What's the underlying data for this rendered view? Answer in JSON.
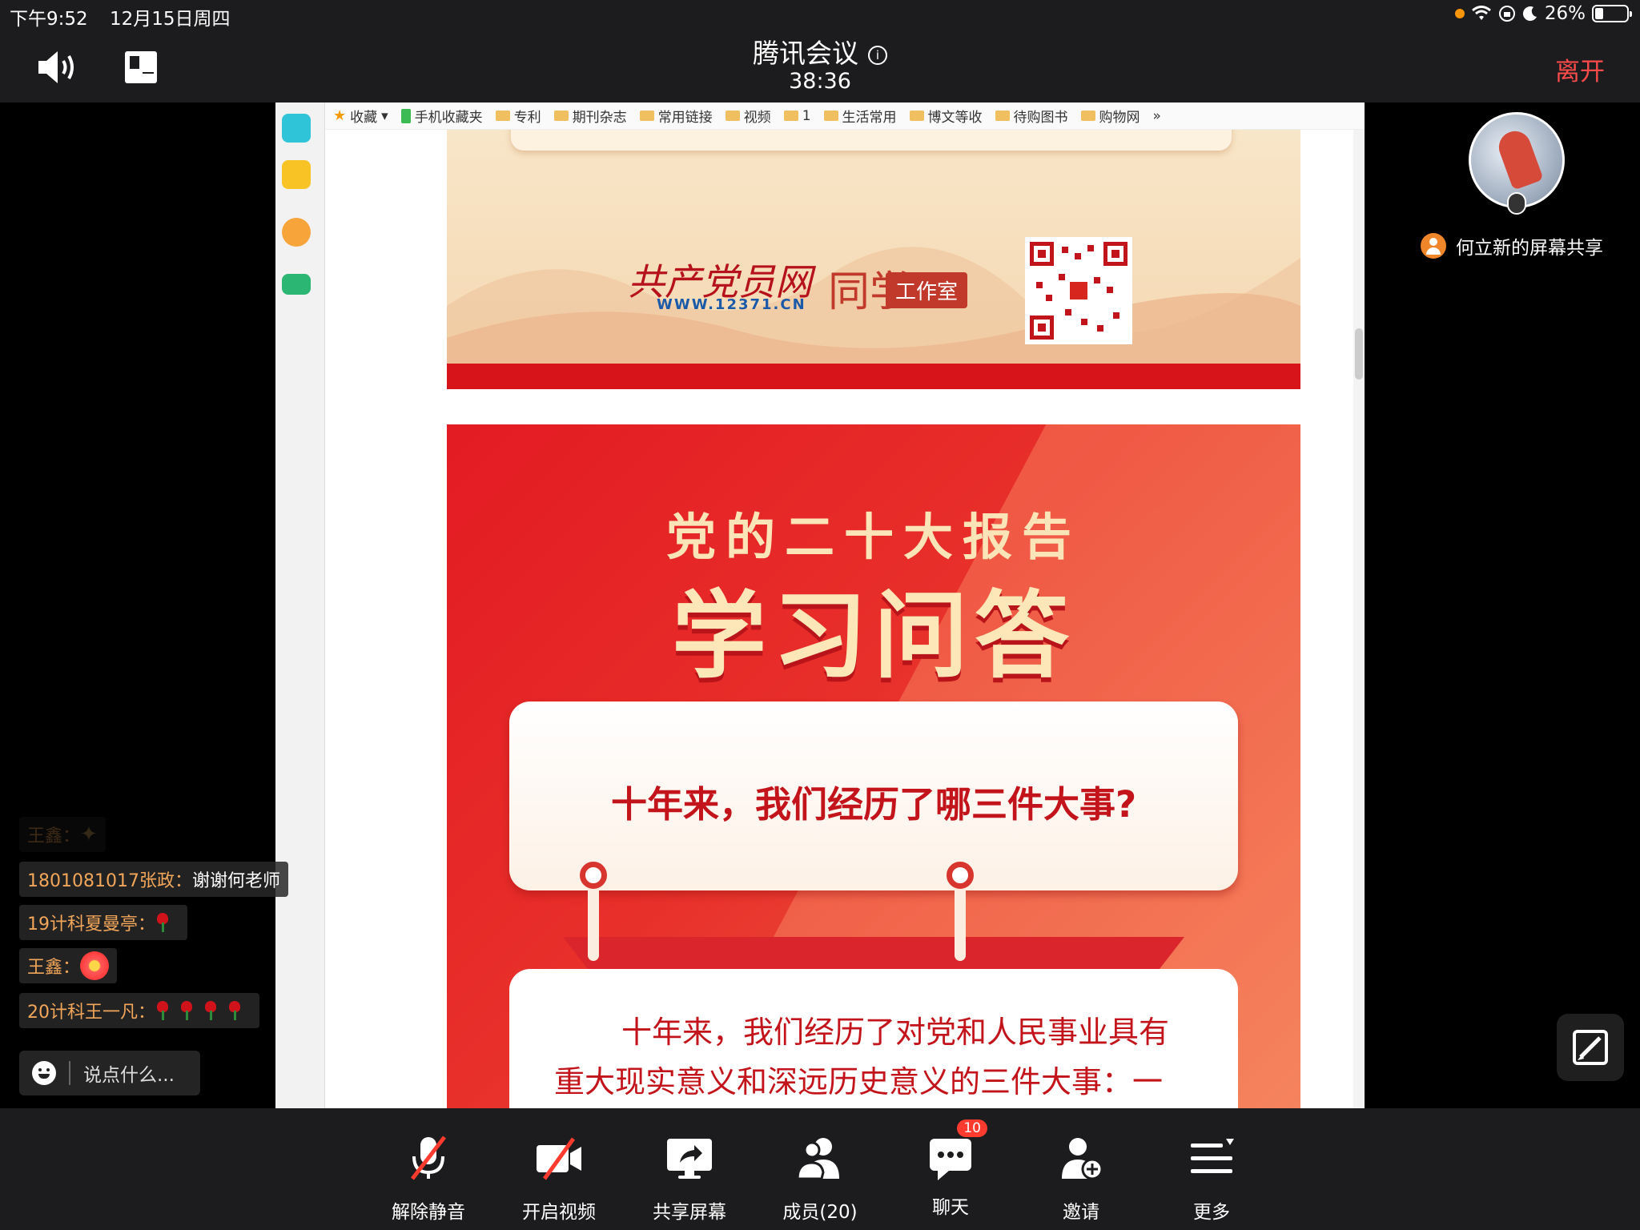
{
  "status_bar": {
    "time": "下午9:52",
    "date": "12月15日周四",
    "battery": "26%"
  },
  "header": {
    "title": "腾讯会议",
    "duration": "38:36",
    "leave_label": "离开"
  },
  "browser": {
    "bookmarks": [
      "收藏",
      "手机收藏夹",
      "专利",
      "期刊杂志",
      "常用链接",
      "视频",
      "1",
      "生活常用",
      "博文等收",
      "待购图书",
      "购物网",
      "»"
    ]
  },
  "poster": {
    "logo_main": "共产党员网",
    "logo_url": "WWW.12371.CN",
    "logo_tongxue": "同学",
    "logo_studio": "工作室",
    "subtitle": "党的二十大报告",
    "title": "学习问答",
    "question": "十年来，我们经历了哪三件大事?",
    "answer_line1": "十年来，我们经历了对党和人民事业具有",
    "answer_line2": "重大现实意义和深远历史意义的三件大事：一"
  },
  "participant": {
    "sharer_label": "何立新的屏幕共享"
  },
  "chat": {
    "messages": [
      {
        "sender": "王鑫：",
        "text": ""
      },
      {
        "sender": "1801081017张政：",
        "text": "谢谢何老师"
      },
      {
        "sender": "19计科夏曼亭：",
        "text": ""
      },
      {
        "sender": "王鑫：",
        "text": ""
      },
      {
        "sender": "20计科王一凡：",
        "text": ""
      }
    ],
    "input_placeholder": "说点什么..."
  },
  "toolbar": {
    "unmute": "解除静音",
    "start_video": "开启视频",
    "share_screen": "共享屏幕",
    "members": "成员(20)",
    "chat": "聊天",
    "chat_badge": "10",
    "invite": "邀请",
    "more": "更多"
  },
  "colors": {
    "leave": "#ff4b4b",
    "poster_red": "#e31b23",
    "chat_sender": "#f2a65a"
  }
}
